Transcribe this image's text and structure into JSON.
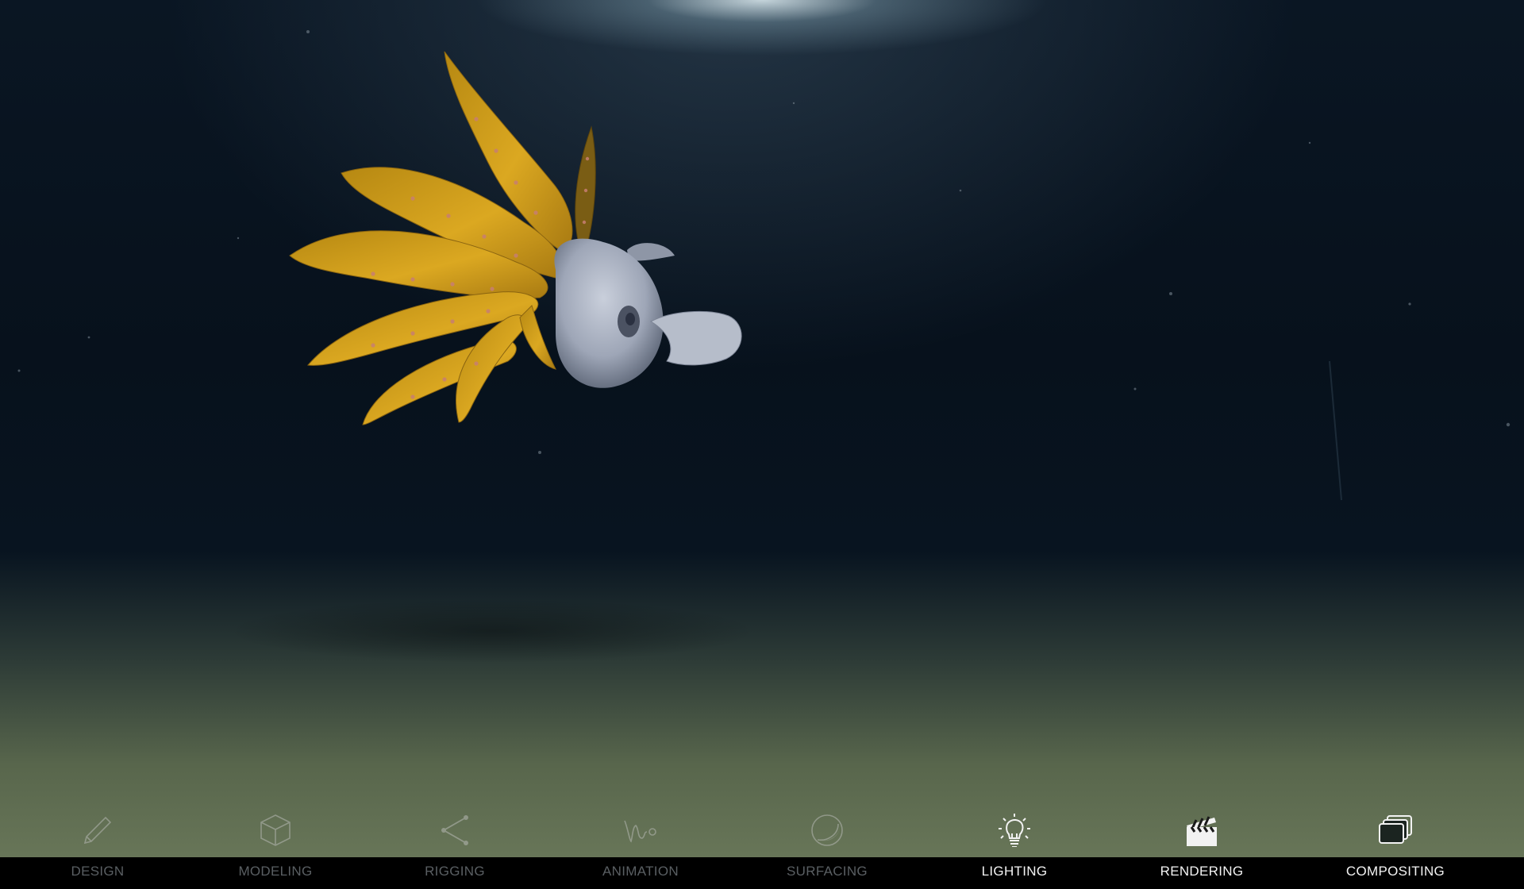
{
  "toolbar": {
    "tools": [
      {
        "label": "DESIGN",
        "icon": "pencil-icon",
        "state": "inactive"
      },
      {
        "label": "MODELING",
        "icon": "cube-icon",
        "state": "inactive"
      },
      {
        "label": "RIGGING",
        "icon": "bone-joint-icon",
        "state": "inactive"
      },
      {
        "label": "ANIMATION",
        "icon": "motion-path-icon",
        "state": "inactive"
      },
      {
        "label": "SURFACING",
        "icon": "sphere-icon",
        "state": "inactive"
      },
      {
        "label": "LIGHTING",
        "icon": "light-bulb-icon",
        "state": "active"
      },
      {
        "label": "RENDERING",
        "icon": "clapperboard-icon",
        "state": "active"
      },
      {
        "label": "COMPOSITING",
        "icon": "stacked-layers-icon",
        "state": "active"
      }
    ]
  },
  "colors": {
    "water": "#07111c",
    "seafloor": "#6d7b5c",
    "fins": "#d9a51e",
    "body": "#b9c0ce",
    "label_active": "#f3f3f3",
    "label_inactive": "#5a5f63"
  }
}
